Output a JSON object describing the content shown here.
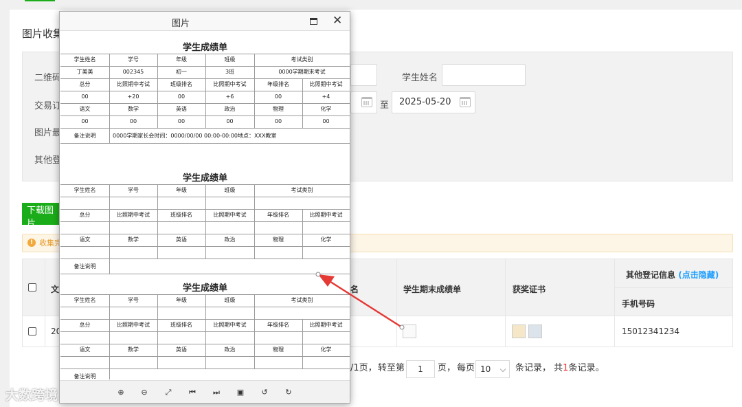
{
  "page": {
    "title": "图片收集"
  },
  "filters": {
    "row1": {
      "label": "二维码",
      "student_name_label": "学生姓名",
      "student_name_value": ""
    },
    "row2": {
      "label": "交易订",
      "to_label": "至",
      "date_end": "2025-05-20"
    },
    "row3": {
      "label": "图片最"
    },
    "row4": {
      "label": "其他登"
    }
  },
  "toolbar": {
    "download_label": "下载图片"
  },
  "notice": {
    "text": "收集完"
  },
  "table": {
    "headers": {
      "col1": "文",
      "col_name": "名",
      "report": "学生期末成绩单",
      "award": "获奖证书",
      "other": "其他登记信息",
      "other_link": "(点击隐藏)",
      "phone": "手机号码"
    },
    "rows": [
      {
        "col1": "20",
        "phone": "15012341234"
      }
    ]
  },
  "pager": {
    "page_of": "/1页，",
    "goto": "转至第",
    "current": "1",
    "page_unit": "页，",
    "per": "每页",
    "size": "10",
    "records_pre": "条记录，",
    "total_pre": "共",
    "total": "1",
    "total_post": "条记录。"
  },
  "modal": {
    "title": "图片",
    "sheet_title": "学生成绩单",
    "row1_headers": [
      "学生姓名",
      "学号",
      "年级",
      "班级",
      "考试类别"
    ],
    "row1_values": [
      "丁美美",
      "002345",
      "初一",
      "3班",
      "0000学期期末考试"
    ],
    "row2_headers": [
      "总分",
      "比照期中考试",
      "班级排名",
      "比照期中考试",
      "年级排名",
      "比照期中考试"
    ],
    "row2_values": [
      "00",
      "+20",
      "00",
      "+6",
      "00",
      "+4"
    ],
    "row3_headers": [
      "语文",
      "数学",
      "英语",
      "政治",
      "物理",
      "化学"
    ],
    "row3_values": [
      "00",
      "00",
      "00",
      "00",
      "00",
      "00"
    ],
    "remark_label": "备注说明",
    "remark_text": "0000学期家长会时间：0000/00/00 00:00-00:00地点：XXX教室",
    "tools": [
      "zoom-in-icon",
      "zoom-out-icon",
      "fit-icon",
      "first-icon",
      "last-icon",
      "image-icon",
      "rotate-left-icon",
      "rotate-right-icon"
    ]
  },
  "watermark": {
    "text": "大数跨境"
  },
  "colors": {
    "primary_green": "#1aad19",
    "link_blue": "#1e9fff",
    "arrow_red": "#e53935",
    "notice_orange": "#e69a28"
  }
}
